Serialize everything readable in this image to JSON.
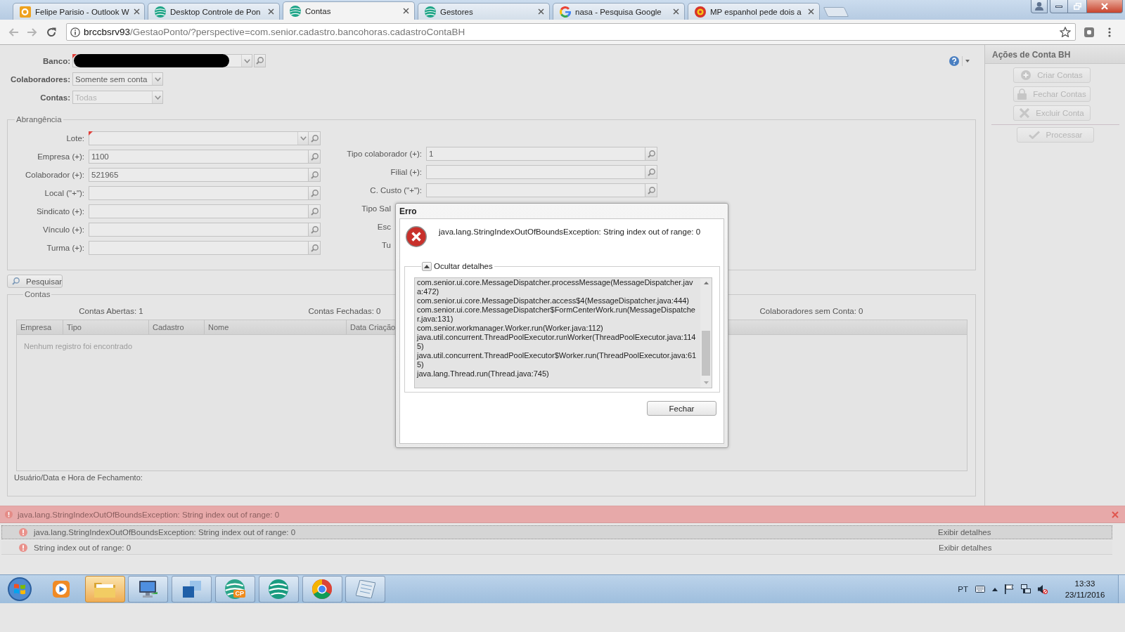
{
  "browser": {
    "tabs": [
      {
        "title": "Felipe Parisio - Outlook W",
        "kind": "mail",
        "selected": false
      },
      {
        "title": "Desktop Controle de Pon",
        "kind": "app",
        "selected": false
      },
      {
        "title": "Contas",
        "kind": "app",
        "selected": true
      },
      {
        "title": "Gestores",
        "kind": "app",
        "selected": false
      },
      {
        "title": "nasa - Pesquisa Google",
        "kind": "search",
        "selected": false
      },
      {
        "title": "MP espanhol pede dois a",
        "kind": "news",
        "selected": false
      }
    ],
    "address": {
      "host": "brccbsrv93",
      "path": "/GestaoPonto/?perspective=com.senior.cadastro.bancohoras.cadastroContaBH"
    }
  },
  "header_fields": [
    {
      "label": "Banco:",
      "kind": "combo-lookup",
      "required": true,
      "redacted": true,
      "disabled": false
    },
    {
      "label": "Colaboradores:",
      "kind": "combo",
      "value": "Somente sem conta",
      "required": false,
      "redacted": false,
      "disabled": false
    },
    {
      "label": "Contas:",
      "kind": "combo",
      "value": "Todas",
      "required": false,
      "redacted": false,
      "disabled": true
    }
  ],
  "scope": {
    "title": "Abrangência",
    "left": [
      {
        "label": "Lote:",
        "kind": "combo-lookup",
        "required": true
      },
      {
        "label": "Empresa (+):",
        "kind": "lookup",
        "value": "1100",
        "required": false
      },
      {
        "label": "Colaborador (+):",
        "kind": "lookup",
        "value": "521965",
        "required": false
      },
      {
        "label": "Local (\"+\"):",
        "kind": "lookup",
        "required": false
      },
      {
        "label": "Sindicato (+):",
        "kind": "lookup",
        "required": false
      },
      {
        "label": "Vínculo (+):",
        "kind": "lookup",
        "required": false
      },
      {
        "label": "Turma (+):",
        "kind": "lookup",
        "required": false
      }
    ],
    "right": [
      {
        "label": "Tipo colaborador (+):",
        "kind": "lookup",
        "value": "1",
        "required": false
      },
      {
        "label": "Filial (+):",
        "kind": "lookup",
        "required": false
      },
      {
        "label": "C. Custo (\"+\"):",
        "kind": "lookup",
        "required": false
      },
      {
        "label": "Tipo Sal",
        "kind": "covered"
      },
      {
        "label": "Esc",
        "kind": "covered"
      },
      {
        "label": "Tu",
        "kind": "covered"
      }
    ]
  },
  "search_button": "Pesquisar",
  "accounts": {
    "title": "Contas",
    "summary": [
      "Contas Abertas: 1",
      "Contas Fechadas: 0",
      "Colaboradores sem Conta: 0"
    ],
    "columns": [
      "Empresa",
      "Tipo",
      "Cadastro",
      "Nome",
      "Data Criação"
    ],
    "empty_message": "Nenhum registro foi encontrado",
    "closing_label": "Usuário/Data e Hora de Fechamento:"
  },
  "actions_panel": {
    "title": "Ações de Conta BH",
    "groups": [
      {
        "actions": [
          {
            "label": "Criar Contas",
            "kind": "create",
            "disabled": true
          },
          {
            "label": "Fechar Contas",
            "kind": "lock",
            "disabled": true
          },
          {
            "label": "Excluir Conta",
            "kind": "delete",
            "disabled": true
          }
        ]
      },
      {
        "actions": [
          {
            "label": "Processar",
            "kind": "process",
            "disabled": true
          }
        ]
      }
    ]
  },
  "error_bar": {
    "message": "java.lang.StringIndexOutOfBoundsException: String index out of range: 0",
    "items": [
      {
        "message": "java.lang.StringIndexOutOfBoundsException: String index out of range: 0",
        "action": "Exibir detalhes",
        "selected": true
      },
      {
        "message": "String index out of range: 0",
        "action": "Exibir detalhes",
        "selected": false
      }
    ]
  },
  "dialog": {
    "title": "Erro",
    "message": "java.lang.StringIndexOutOfBoundsException: String index out of range: 0",
    "details_toggle": {
      "label": "Ocultar detalhes",
      "expanded": true
    },
    "details": [
      "com.senior.ui.core.MessageDispatcher.processMessage(MessageDispatcher.java:472)",
      "com.senior.ui.core.MessageDispatcher.access$4(MessageDispatcher.java:444)",
      "com.senior.ui.core.MessageDispatcher$FormCenterWork.run(MessageDispatcher.java:131)",
      "com.senior.workmanager.Worker.run(Worker.java:112)",
      "java.util.concurrent.ThreadPoolExecutor.runWorker(ThreadPoolExecutor.java:1145)",
      "java.util.concurrent.ThreadPoolExecutor$Worker.run(ThreadPoolExecutor.java:615)",
      "java.lang.Thread.run(Thread.java:745)"
    ],
    "close_button": "Fechar"
  },
  "taskbar": {
    "apps": [
      {
        "kind": "player",
        "running": false,
        "highlighted": false
      },
      {
        "kind": "folders",
        "running": true,
        "highlighted": true
      },
      {
        "kind": "remote",
        "running": true,
        "highlighted": false
      },
      {
        "kind": "tiles",
        "running": true,
        "highlighted": false
      },
      {
        "kind": "tagged-globe",
        "label": "CP",
        "running": true,
        "highlighted": false
      },
      {
        "kind": "globe",
        "running": true,
        "highlighted": false
      },
      {
        "kind": "wheel",
        "running": true,
        "highlighted": false
      },
      {
        "kind": "notepad",
        "running": true,
        "highlighted": false
      }
    ],
    "language": "PT",
    "time": "13:33",
    "date": "23/11/2016"
  }
}
